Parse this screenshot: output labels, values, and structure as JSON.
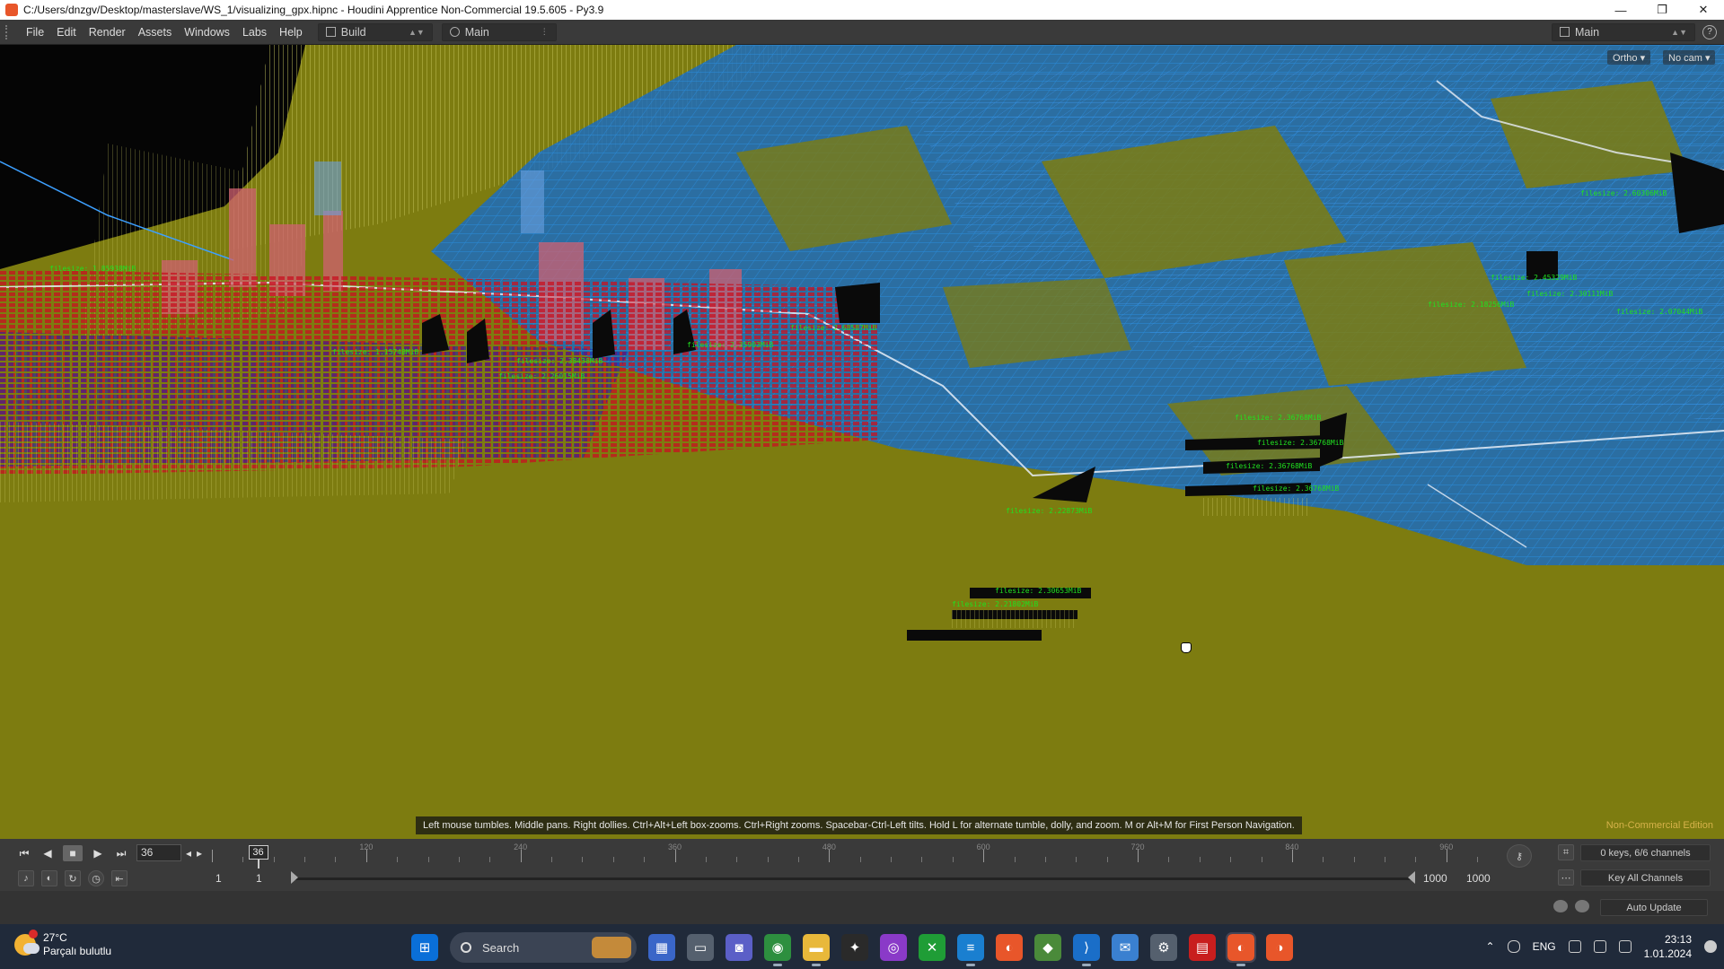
{
  "window": {
    "title": "C:/Users/dnzgv/Desktop/masterslave/WS_1/visualizing_gpx.hipnc - Houdini Apprentice Non-Commercial 19.5.605 - Py3.9",
    "minimize": "—",
    "maximize": "❐",
    "close": "✕"
  },
  "menu": {
    "items": [
      "File",
      "Edit",
      "Render",
      "Assets",
      "Windows",
      "Labs",
      "Help"
    ],
    "desktop": "Build",
    "network": "Main",
    "right_network": "Main"
  },
  "viewport": {
    "ortho_label": "Ortho ▾",
    "camera_label": "No cam ▾",
    "hint": "Left mouse tumbles. Middle pans. Right dollies. Ctrl+Alt+Left box-zooms. Ctrl+Right zooms. Spacebar-Ctrl-Left tilts. Hold L for alternate tumble, dolly, and zoom.     M or Alt+M for First Person Navigation.",
    "noncommercial": "Non-Commercial Edition",
    "ground_color": "#7d7c10",
    "mesh_color": "#1e78c8",
    "label_color": "#20e020",
    "label_sample": "filesize: 2.36768MiB"
  },
  "timeline": {
    "current_frame": "36",
    "playhead_frame": 36,
    "ruler_labels": [
      "120",
      "240",
      "360",
      "480",
      "600",
      "720",
      "840",
      "960"
    ],
    "start_frame": "1",
    "start_frame_2": "1",
    "end_frame": "1000",
    "end_frame_2": "1000",
    "keys_channels": "0 keys, 6/6 channels",
    "key_all": "Key All Channels",
    "auto_update": "Auto Update"
  },
  "taskbar": {
    "temperature": "27°C",
    "weather": "Parçalı bulutlu",
    "search": "Search",
    "language": "ENG",
    "time": "23:13",
    "date": "1.01.2024"
  }
}
